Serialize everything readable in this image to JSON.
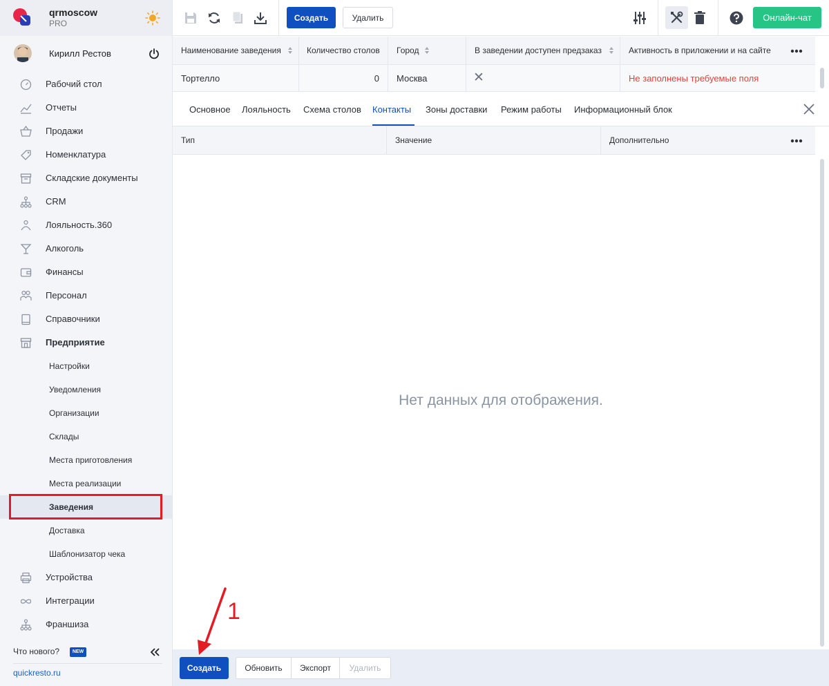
{
  "brand": {
    "name": "qrmoscow",
    "plan": "PRO"
  },
  "user": {
    "name": "Кирилл Рестов"
  },
  "sidebar": {
    "items": [
      {
        "label": "Рабочий стол",
        "icon": "gauge-icon"
      },
      {
        "label": "Отчеты",
        "icon": "chart-icon"
      },
      {
        "label": "Продажи",
        "icon": "basket-icon"
      },
      {
        "label": "Номенклатура",
        "icon": "tag-icon"
      },
      {
        "label": "Складские документы",
        "icon": "archive-icon"
      },
      {
        "label": "CRM",
        "icon": "hierarchy-icon"
      },
      {
        "label": "Лояльность.360",
        "icon": "loyalty-icon"
      },
      {
        "label": "Алкоголь",
        "icon": "cocktail-icon"
      },
      {
        "label": "Финансы",
        "icon": "wallet-icon"
      },
      {
        "label": "Персонал",
        "icon": "people-icon"
      },
      {
        "label": "Справочники",
        "icon": "book-icon"
      },
      {
        "label": "Предприятие",
        "icon": "store-icon"
      }
    ],
    "sub_items": [
      {
        "label": "Настройки"
      },
      {
        "label": "Уведомления"
      },
      {
        "label": "Организации"
      },
      {
        "label": "Склады"
      },
      {
        "label": "Места приготовления"
      },
      {
        "label": "Места реализации"
      },
      {
        "label": "Заведения"
      },
      {
        "label": "Доставка"
      },
      {
        "label": "Шаблонизатор чека"
      }
    ],
    "items_after": [
      {
        "label": "Устройства",
        "icon": "printer-icon"
      },
      {
        "label": "Интеграции",
        "icon": "infinity-icon"
      },
      {
        "label": "Франшиза",
        "icon": "hierarchy-icon"
      }
    ],
    "whats_new": "Что нового?",
    "new_badge": "NEW",
    "site_link": "quickresto.ru"
  },
  "toolbar": {
    "create_label": "Создать",
    "delete_label": "Удалить",
    "chat_label": "Онлайн-чат"
  },
  "grid": {
    "columns": [
      "Наименование заведения",
      "Количество столов",
      "Город",
      "В заведении доступен предзаказ",
      "Активность в приложении и на сайте"
    ],
    "rows": [
      {
        "name": "Тортелло",
        "tables": "0",
        "city": "Москва",
        "preorder": "✕",
        "activity": "Не заполнены требуемые поля"
      }
    ]
  },
  "tabs": [
    {
      "label": "Основное"
    },
    {
      "label": "Лояльность"
    },
    {
      "label": "Схема столов"
    },
    {
      "label": "Контакты"
    },
    {
      "label": "Зоны доставки"
    },
    {
      "label": "Режим работы"
    },
    {
      "label": "Информационный блок"
    }
  ],
  "contacts": {
    "columns": [
      "Тип",
      "Значение",
      "Дополнительно"
    ],
    "empty_text": "Нет данных для отображения."
  },
  "bottombar": {
    "create_label": "Создать",
    "refresh_label": "Обновить",
    "export_label": "Экспорт",
    "delete_label": "Удалить"
  },
  "annotation": {
    "number": "1"
  },
  "colors": {
    "primary": "#0f4fbf",
    "chat": "#26c485",
    "error": "#e0413d",
    "highlight": "#e21c24"
  }
}
